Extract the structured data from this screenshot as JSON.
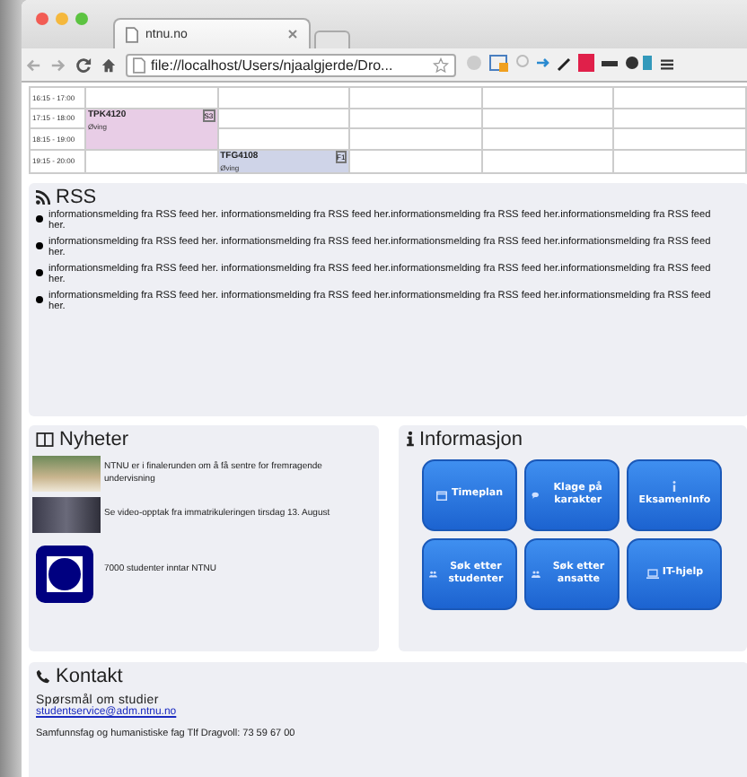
{
  "browser": {
    "tab_title": "ntnu.no",
    "url": "file://localhost/Users/njaalgjerde/Dro..."
  },
  "calendar": {
    "rows": [
      {
        "time": "16:15 - 17:00",
        "cells": [
          {
            "kind": "empty"
          },
          {
            "kind": "empty"
          },
          {
            "kind": "empty"
          },
          {
            "kind": "empty"
          },
          {
            "kind": "empty"
          }
        ]
      },
      {
        "time": "17:15 - 18:00",
        "cells": [
          {
            "kind": "event",
            "code": "TPK4120",
            "type": "Øving",
            "badge": "S3",
            "color": "#e8cde6"
          },
          {
            "kind": "empty"
          },
          {
            "kind": "empty"
          },
          {
            "kind": "empty"
          },
          {
            "kind": "empty"
          }
        ]
      },
      {
        "time": "18:15 - 19:00",
        "cells": [
          {
            "kind": "continued"
          },
          {
            "kind": "empty"
          },
          {
            "kind": "empty"
          },
          {
            "kind": "empty"
          },
          {
            "kind": "empty"
          }
        ]
      },
      {
        "time": "19:15 - 20:00",
        "cells": [
          {
            "kind": "empty"
          },
          {
            "kind": "event",
            "code": "TFG4108",
            "type": "Øving",
            "badge": "F1",
            "color": "#cfd4e8"
          },
          {
            "kind": "empty"
          },
          {
            "kind": "empty"
          },
          {
            "kind": "empty"
          }
        ]
      }
    ]
  },
  "rss": {
    "title": "RSS",
    "items": [
      "informationsmelding fra RSS feed her. informationsmelding fra RSS feed her.informationsmelding fra RSS feed her.informationsmelding fra RSS feed her.",
      "informationsmelding fra RSS feed her. informationsmelding fra RSS feed her.informationsmelding fra RSS feed her.informationsmelding fra RSS feed her.",
      "informationsmelding fra RSS feed her. informationsmelding fra RSS feed her.informationsmelding fra RSS feed her.informationsmelding fra RSS feed her.",
      "informationsmelding fra RSS feed her. informationsmelding fra RSS feed her.informationsmelding fra RSS feed her.informationsmelding fra RSS feed her."
    ]
  },
  "news": {
    "title": "Nyheter",
    "items": [
      {
        "kind": "photo",
        "text": "NTNU er i finalerunden om å få sentre for fremragende undervisning"
      },
      {
        "kind": "video",
        "text": "Se video-opptak fra immatrikuleringen tirsdag 13. August"
      },
      {
        "kind": "logo",
        "text": "7000 studenter inntar NTNU"
      }
    ]
  },
  "info": {
    "title": "Informasjon",
    "buttons": [
      "Timeplan",
      "Klage på karakter",
      "EksamenInfo",
      "Søk etter studenter",
      "Søk etter ansatte",
      "IT-hjelp"
    ]
  },
  "contact": {
    "title": "Kontakt",
    "question": "Spørsmål om studier",
    "email": "studentservice@adm.ntnu.no",
    "phone": "Samfunnsfag og humanistiske fag Tlf Dragvoll: 73 59 67 00"
  }
}
